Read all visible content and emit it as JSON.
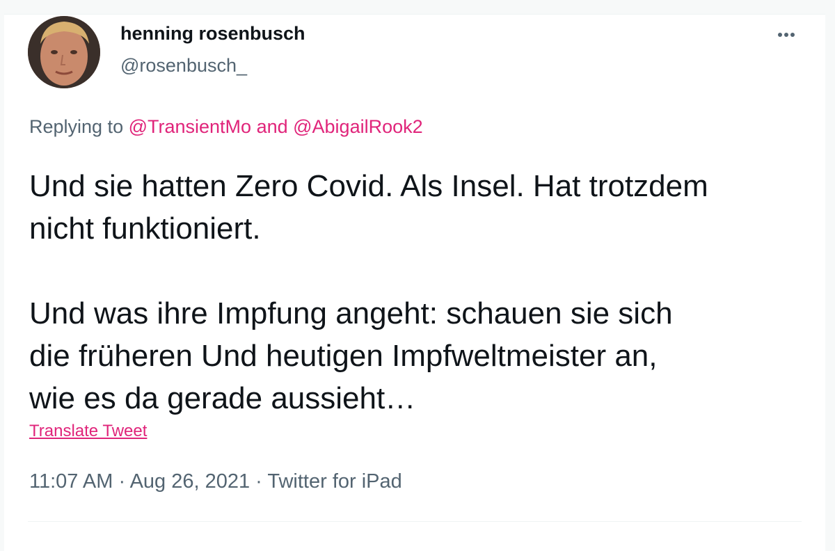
{
  "author": {
    "display_name": "henning rosenbusch",
    "handle": "@rosenbusch_"
  },
  "reply": {
    "prefix": "Replying to ",
    "mention1": "@TransientMo",
    "conjunction": " and ",
    "mention2": "@AbigailRook2"
  },
  "tweet": {
    "text": "Und sie hatten Zero Covid. Als Insel. Hat trotzdem\nnicht funktioniert.\n\nUnd was ihre Impfung angeht: schauen sie sich\ndie früheren Und heutigen Impfweltmeister an,\nwie es da gerade aussieht…",
    "translate_label": "Translate Tweet",
    "time": "11:07 AM",
    "separator1": " · ",
    "date": "Aug 26, 2021",
    "separator2": " · ",
    "source": "Twitter for iPad"
  },
  "icons": {
    "more": "more-horizontal-icon",
    "avatar": "profile-photo"
  },
  "colors": {
    "accent": "#e0247a",
    "text_primary": "#0f1419",
    "text_secondary": "#536471",
    "divider": "#eff3f4"
  }
}
